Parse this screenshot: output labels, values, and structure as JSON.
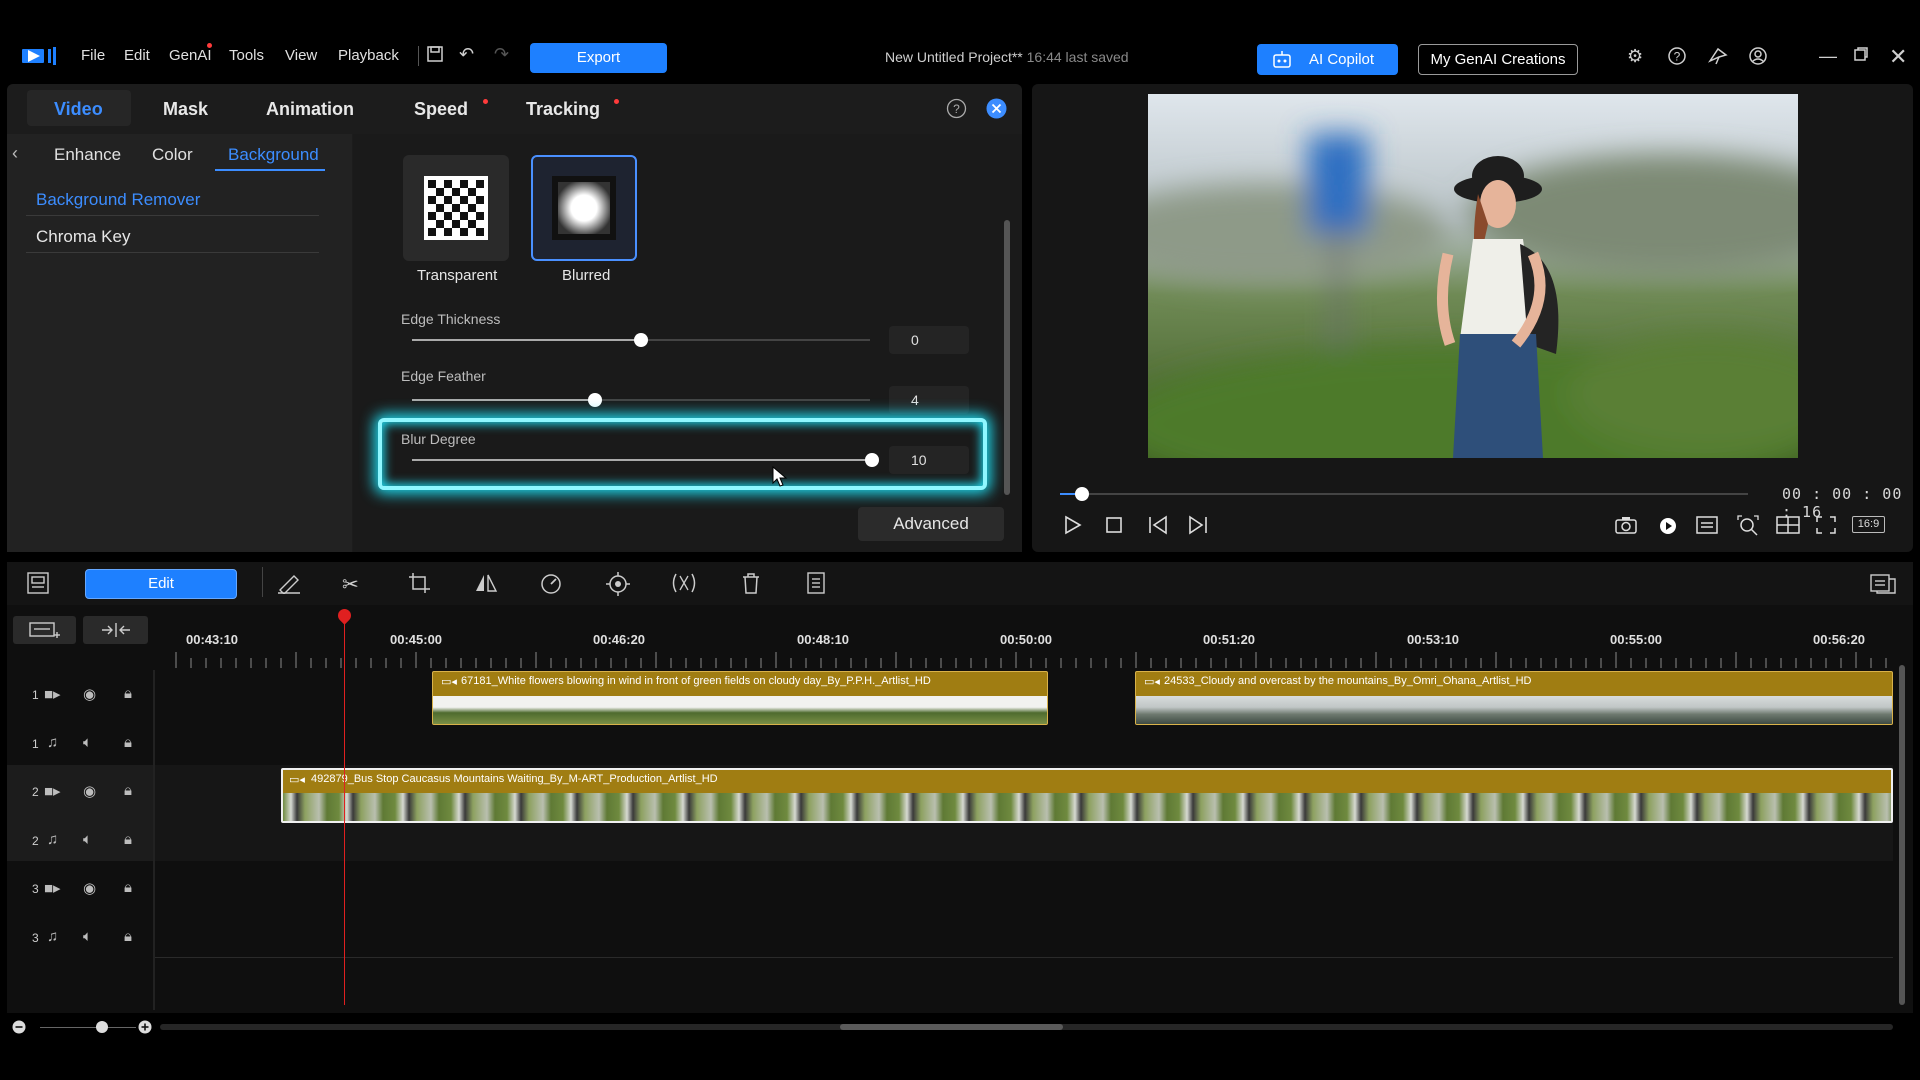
{
  "app": {
    "menu": [
      "File",
      "Edit",
      "GenAI",
      "Tools",
      "View",
      "Playback"
    ],
    "export_label": "Export",
    "project_title": "New Untitled Project**",
    "saved_status": "16:44 last saved",
    "ai_copilot_label": "AI Copilot",
    "my_genai_label": "My GenAI Creations"
  },
  "panel": {
    "tabs": [
      "Video",
      "Mask",
      "Animation",
      "Speed",
      "Tracking"
    ],
    "subtabs": [
      "Enhance",
      "Color",
      "Background"
    ],
    "side_options": [
      "Background Remover",
      "Chroma Key"
    ],
    "bg_options": [
      "Transparent",
      "Blurred"
    ],
    "selected_bg": "Blurred",
    "sliders": [
      {
        "label": "Edge Thickness",
        "value": "0",
        "fraction": 0.5
      },
      {
        "label": "Edge Feather",
        "value": "4",
        "fraction": 0.4
      },
      {
        "label": "Blur Degree",
        "value": "10",
        "fraction": 1.0
      }
    ],
    "advanced_label": "Advanced"
  },
  "preview": {
    "timecode": "00 : 00 : 00 : 16",
    "aspect": "16:9",
    "progress": 0.02
  },
  "timeline": {
    "edit_label": "Edit",
    "ruler": [
      "00:43:10",
      "00:45:00",
      "00:46:20",
      "00:48:10",
      "00:50:00",
      "00:51:20",
      "00:53:10",
      "00:55:00",
      "00:56:20"
    ],
    "tracks": [
      {
        "num": "1",
        "type": "video"
      },
      {
        "num": "1",
        "type": "audio"
      },
      {
        "num": "2",
        "type": "video"
      },
      {
        "num": "2",
        "type": "audio"
      },
      {
        "num": "3",
        "type": "video"
      },
      {
        "num": "3",
        "type": "audio"
      }
    ],
    "clips": [
      {
        "title": "67181_White flowers blowing in wind in front of green fields on cloudy day_By_P.P.H._Artlist_HD"
      },
      {
        "title": "24533_Cloudy and overcast by the mountains_By_Omri_Ohana_Artlist_HD"
      },
      {
        "title": "492879_Bus Stop Caucasus Mountains Waiting_By_M-ART_Production_Artlist_HD"
      }
    ]
  },
  "colors": {
    "accent": "#1e80ff",
    "highlight": "#1ed8ec",
    "clip": "#a07d12",
    "playhead": "#e02020"
  }
}
